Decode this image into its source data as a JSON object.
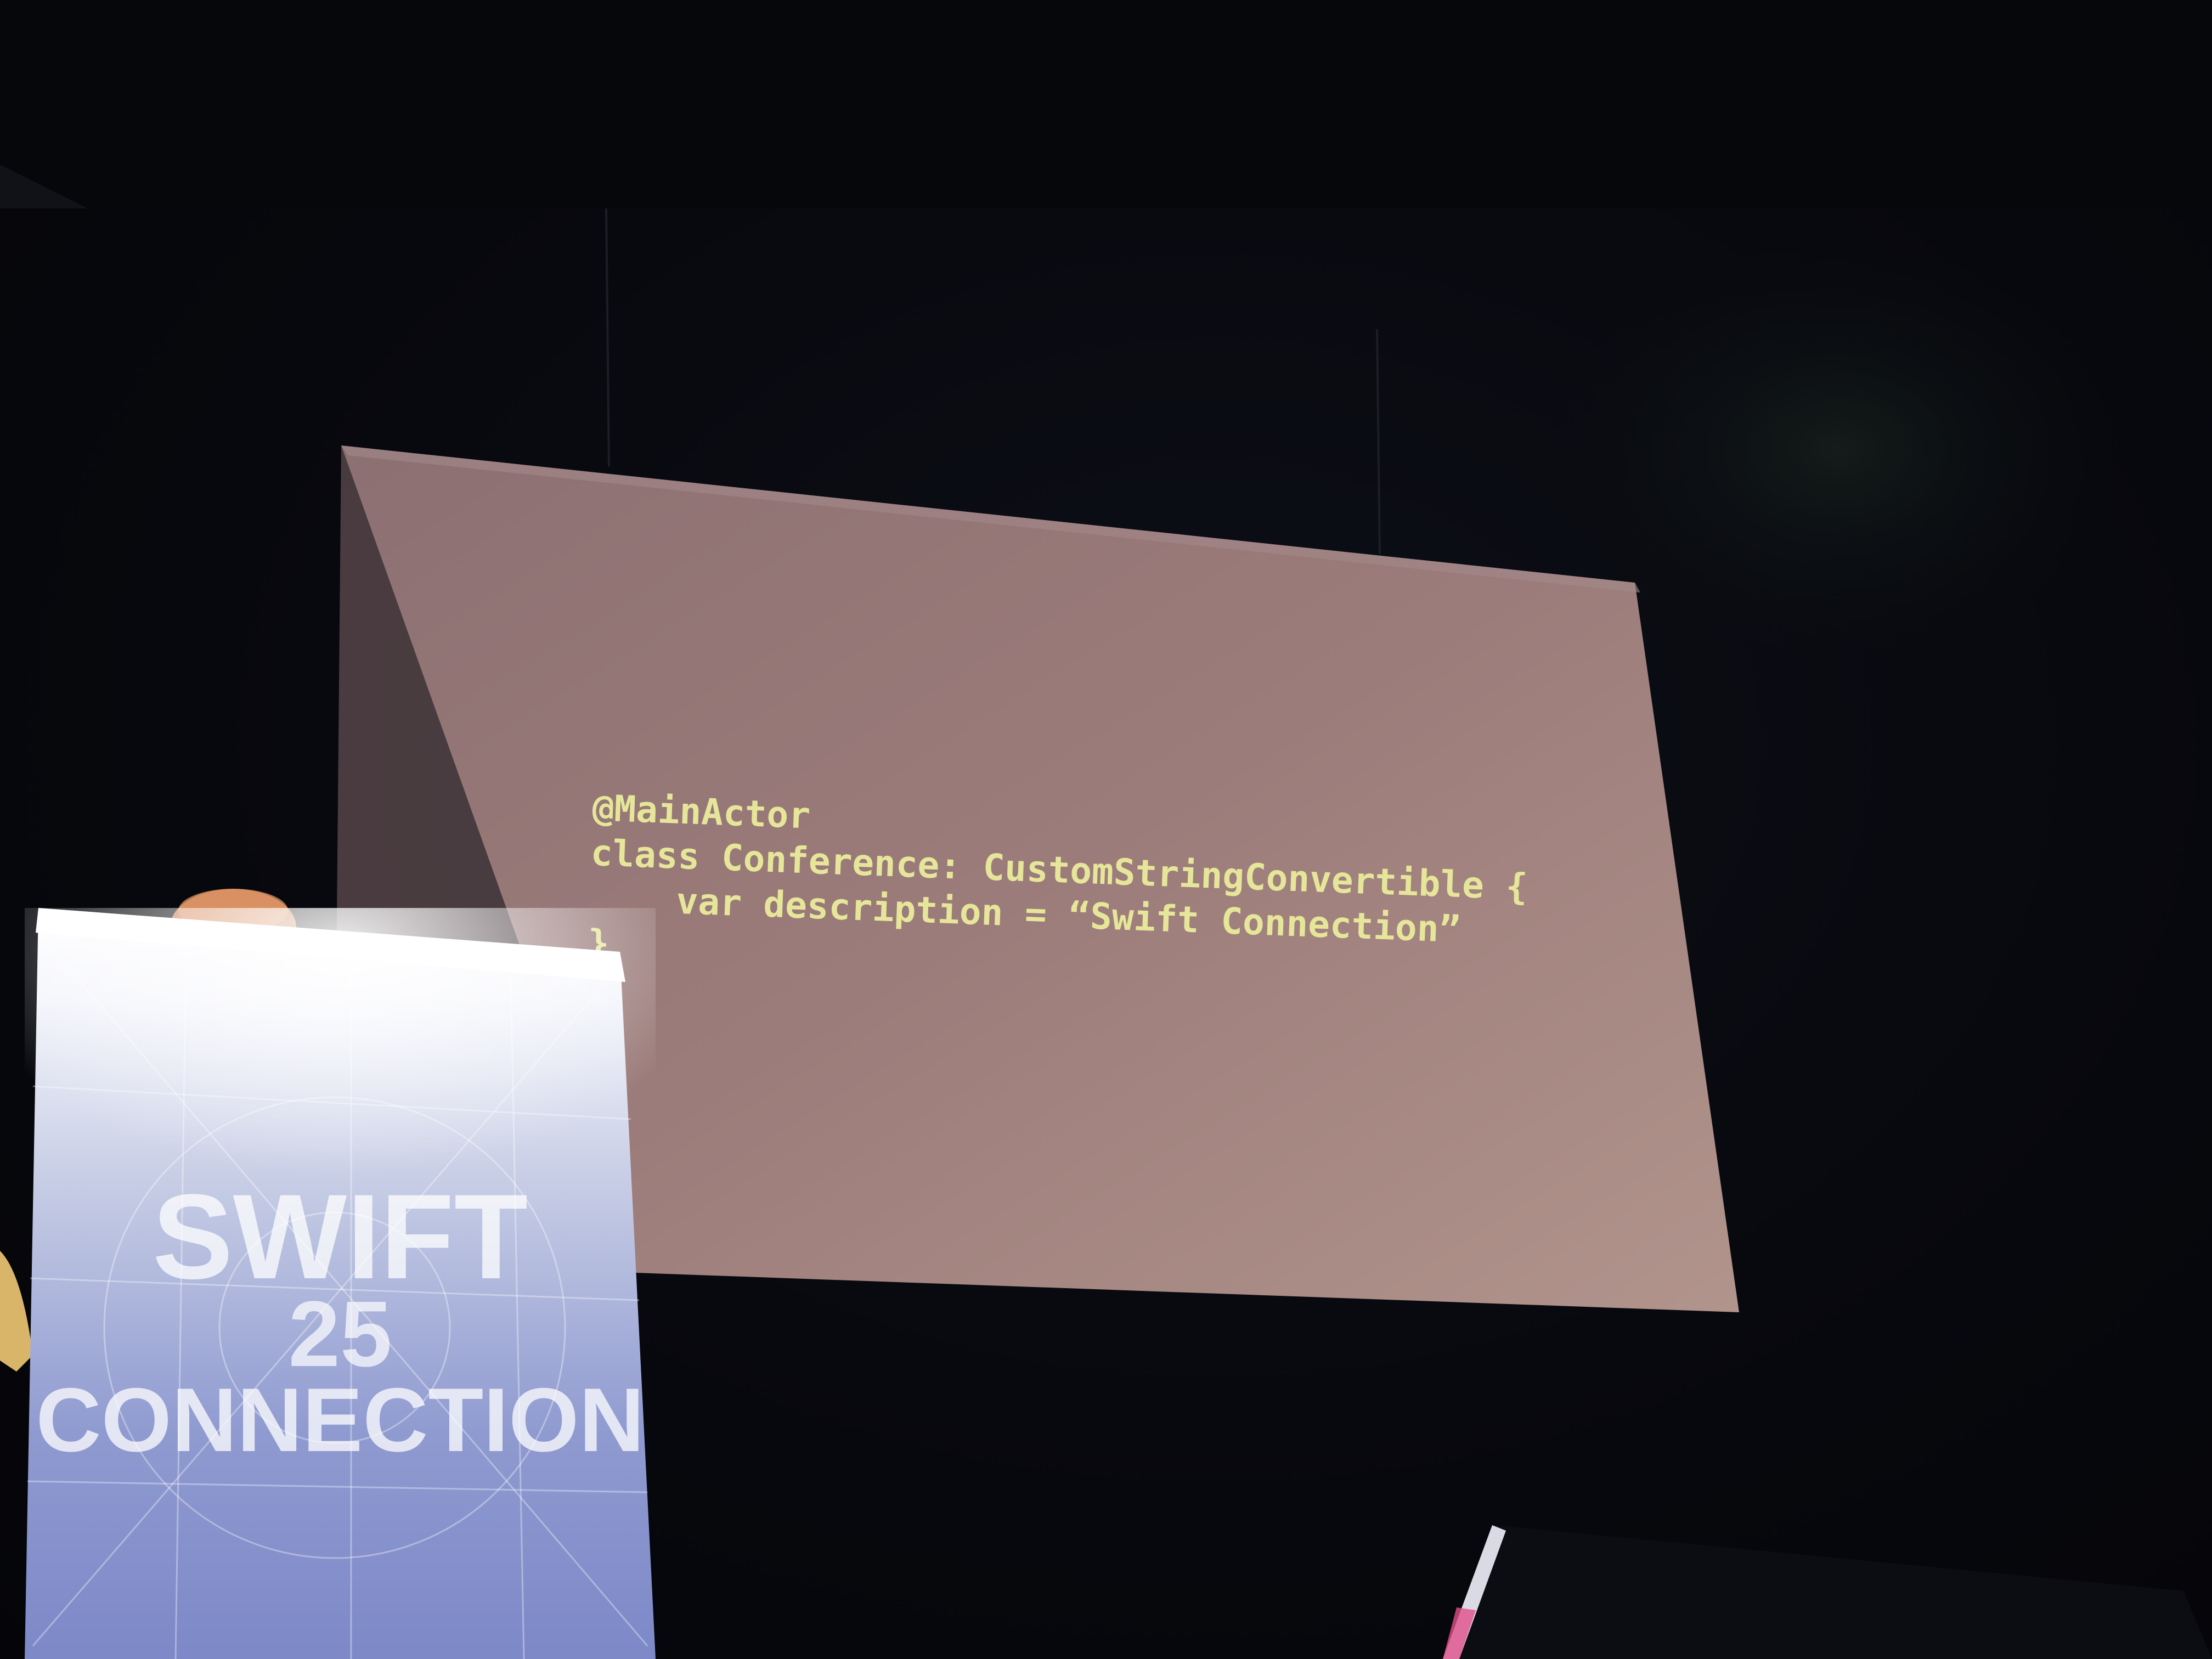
{
  "slide": {
    "code_lines": [
      "@MainActor",
      "class Conference: CustomStringConvertible {",
      "    var description = “Swift Connection”",
      "}"
    ],
    "code_color": "#e6e69a",
    "screen_color": "#9c7c7a"
  },
  "podium": {
    "logo_top": "SWIFT",
    "logo_year": "25",
    "logo_bottom": "CONNECTION"
  }
}
